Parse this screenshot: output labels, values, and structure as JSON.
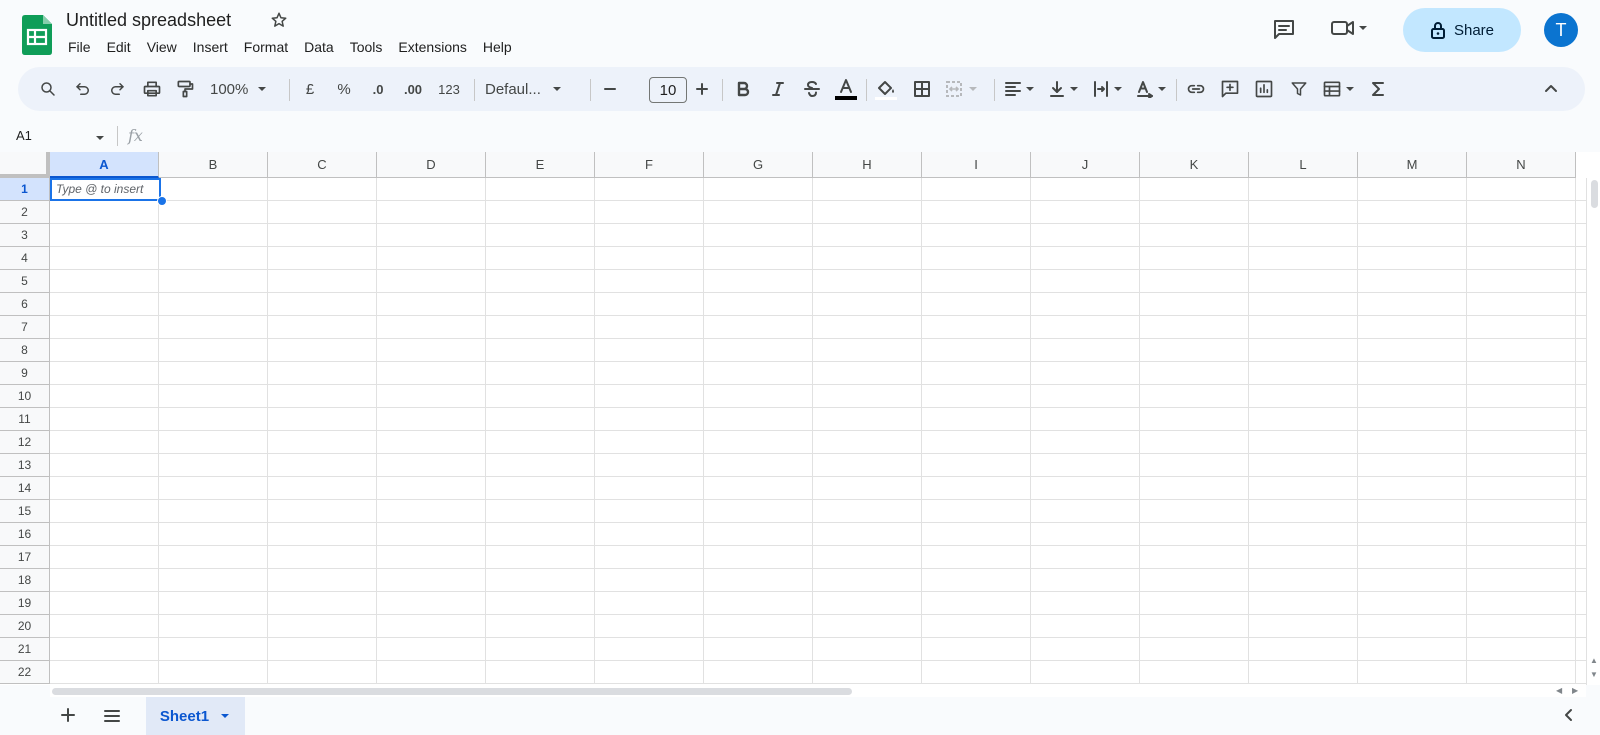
{
  "app": {
    "title": "Untitled spreadsheet",
    "icons": {
      "logo": "google-sheets-logo",
      "star": "star-icon",
      "comments": "comment-icon",
      "meet": "video-camera-icon",
      "lock": "lock-icon"
    },
    "accent_color": "#0b57d0",
    "logo_color": "#0f9d58"
  },
  "menu": [
    "File",
    "Edit",
    "View",
    "Insert",
    "Format",
    "Data",
    "Tools",
    "Extensions",
    "Help"
  ],
  "header": {
    "share_label": "Share",
    "avatar_initial": "T"
  },
  "toolbar": {
    "zoom": "100%",
    "currency": "£",
    "percent": "%",
    "decrease_decimal": ".0",
    "increase_decimal": ".00",
    "number_format": "123",
    "font_family": "Defaul...",
    "font_size": "10"
  },
  "formula_bar": {
    "cell_ref": "A1",
    "fx": "fx",
    "value": ""
  },
  "grid": {
    "columns": [
      "A",
      "B",
      "C",
      "D",
      "E",
      "F",
      "G",
      "H",
      "I",
      "J",
      "K",
      "L",
      "M",
      "N"
    ],
    "rows": [
      "1",
      "2",
      "3",
      "4",
      "5",
      "6",
      "7",
      "8",
      "9",
      "10",
      "11",
      "12",
      "13",
      "14",
      "15",
      "16",
      "17",
      "18",
      "19",
      "20",
      "21",
      "22"
    ],
    "selected_column": "A",
    "selected_row": "1",
    "active_cell_placeholder": "Type @ to insert"
  },
  "sheets": {
    "tabs": [
      "Sheet1"
    ],
    "active": "Sheet1"
  }
}
